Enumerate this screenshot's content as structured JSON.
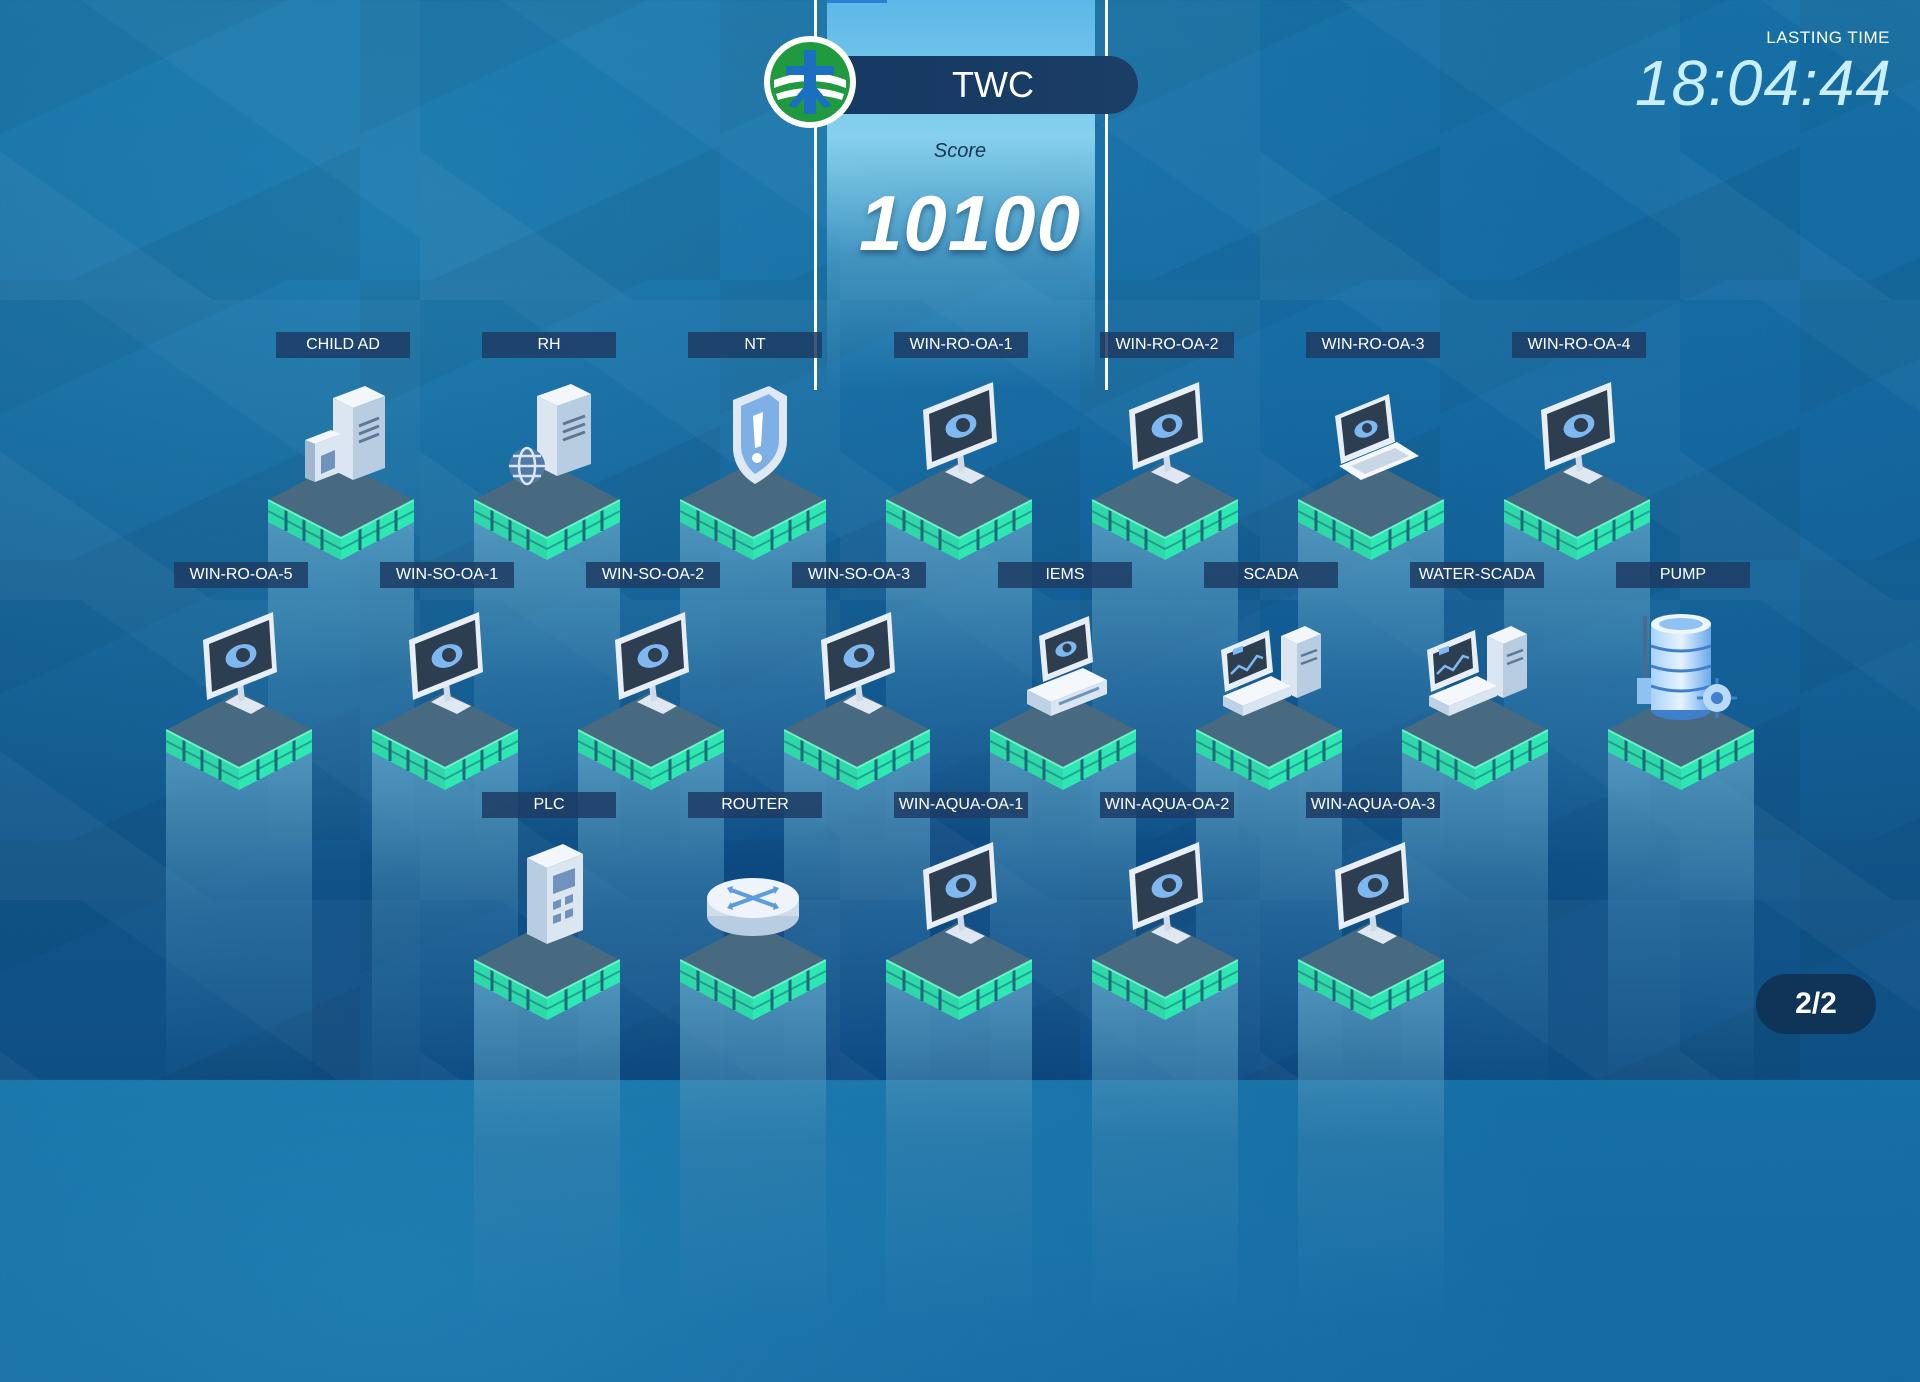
{
  "team": {
    "name": "TWC",
    "logo_icon": "twc-logo"
  },
  "score": {
    "label": "Score",
    "value": "10100"
  },
  "timer": {
    "label": "LASTING TIME",
    "value": "18:04:44"
  },
  "pagination": {
    "text": "2/2"
  },
  "colors": {
    "accent_green": "#2ee8b3",
    "banner": "#1b3e66",
    "page_pill": "#0f3458"
  },
  "rows": [
    {
      "nodes": [
        {
          "label": "CHILD AD",
          "icon": "server-folder-icon"
        },
        {
          "label": "RH",
          "icon": "server-globe-icon"
        },
        {
          "label": "NT",
          "icon": "shield-alert-icon"
        },
        {
          "label": "WIN-RO-OA-1",
          "icon": "monitor-icon"
        },
        {
          "label": "WIN-RO-OA-2",
          "icon": "monitor-icon"
        },
        {
          "label": "WIN-RO-OA-3",
          "icon": "laptop-icon"
        },
        {
          "label": "WIN-RO-OA-4",
          "icon": "monitor-icon"
        }
      ]
    },
    {
      "nodes": [
        {
          "label": "WIN-RO-OA-5",
          "icon": "monitor-icon"
        },
        {
          "label": "WIN-SO-OA-1",
          "icon": "monitor-icon"
        },
        {
          "label": "WIN-SO-OA-2",
          "icon": "monitor-icon"
        },
        {
          "label": "WIN-SO-OA-3",
          "icon": "monitor-icon"
        },
        {
          "label": "IEMS",
          "icon": "workstation-icon"
        },
        {
          "label": "SCADA",
          "icon": "scada-icon"
        },
        {
          "label": "WATER-SCADA",
          "icon": "scada-icon"
        },
        {
          "label": "PUMP",
          "icon": "pump-tank-icon"
        }
      ]
    },
    {
      "nodes": [
        {
          "label": "PLC",
          "icon": "plc-icon"
        },
        {
          "label": "ROUTER",
          "icon": "router-icon"
        },
        {
          "label": "WIN-AQUA-OA-1",
          "icon": "monitor-icon"
        },
        {
          "label": "WIN-AQUA-OA-2",
          "icon": "monitor-icon"
        },
        {
          "label": "WIN-AQUA-OA-3",
          "icon": "monitor-icon"
        }
      ]
    }
  ]
}
